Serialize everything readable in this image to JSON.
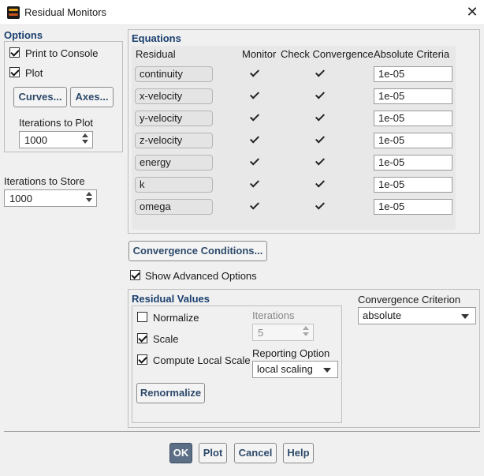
{
  "window": {
    "title": "Residual Monitors"
  },
  "options": {
    "title": "Options",
    "print_to_console": {
      "label": "Print to Console",
      "checked": true
    },
    "plot": {
      "label": "Plot",
      "checked": true
    },
    "curves_button": "Curves...",
    "axes_button": "Axes...",
    "iterations_to_plot": {
      "label": "Iterations to Plot",
      "value": "1000"
    }
  },
  "iterations_to_store": {
    "label": "Iterations to Store",
    "value": "1000"
  },
  "equations": {
    "title": "Equations",
    "headers": {
      "residual": "Residual",
      "monitor": "Monitor",
      "check": "Check Convergence",
      "criteria": "Absolute Criteria"
    },
    "rows": [
      {
        "name": "continuity",
        "criteria": "1e-05"
      },
      {
        "name": "x-velocity",
        "criteria": "1e-05"
      },
      {
        "name": "y-velocity",
        "criteria": "1e-05"
      },
      {
        "name": "z-velocity",
        "criteria": "1e-05"
      },
      {
        "name": "energy",
        "criteria": "1e-05"
      },
      {
        "name": "k",
        "criteria": "1e-05"
      },
      {
        "name": "omega",
        "criteria": "1e-05"
      }
    ]
  },
  "convergence_conditions_button": "Convergence Conditions...",
  "show_advanced_options": {
    "label": "Show Advanced Options",
    "checked": true
  },
  "residual_values": {
    "title": "Residual Values",
    "normalize": {
      "label": "Normalize",
      "checked": false
    },
    "scale": {
      "label": "Scale",
      "checked": true
    },
    "compute_local_scale": {
      "label": "Compute Local Scale",
      "checked": true
    },
    "iterations": {
      "label": "Iterations",
      "value": "5"
    },
    "reporting_option": {
      "label": "Reporting Option",
      "value": "local scaling"
    },
    "renormalize_button": "Renormalize"
  },
  "convergence_criterion": {
    "label": "Convergence Criterion",
    "value": "absolute"
  },
  "footer": {
    "ok": "OK",
    "plot": "Plot",
    "cancel": "Cancel",
    "help": "Help"
  },
  "colors": {
    "group_title": "#1a3f6e",
    "primary_button": "#5c6f86",
    "dialog_bg": "#f0f0f0"
  }
}
